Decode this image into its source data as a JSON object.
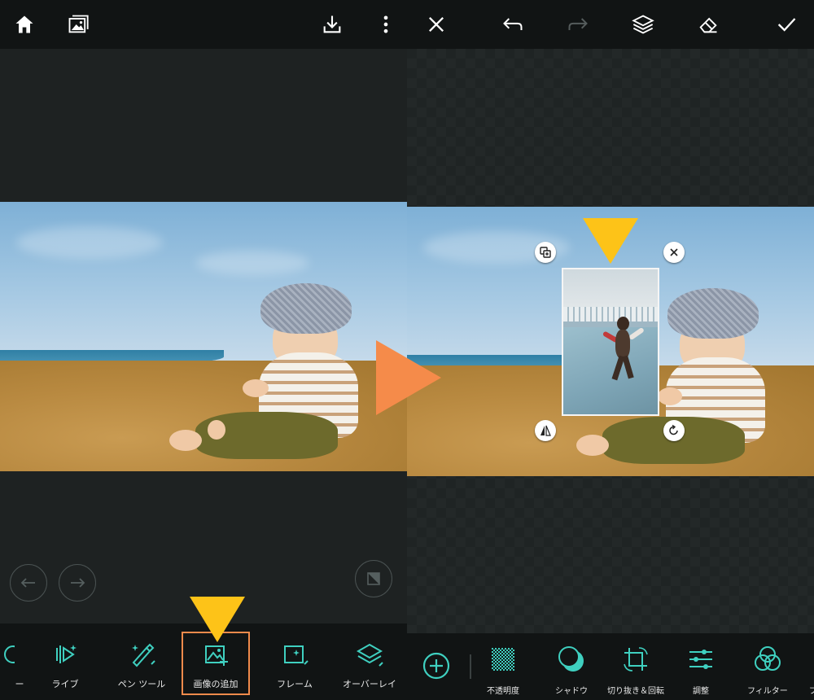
{
  "left_screen": {
    "toolbar": {
      "items": [
        {
          "label": "ー",
          "icon": "partial-tool-icon"
        },
        {
          "label": "ライブ",
          "icon": "live-icon"
        },
        {
          "label": "ペン ツール",
          "icon": "pen-tool-icon"
        },
        {
          "label": "画像の追加",
          "icon": "add-image-icon"
        },
        {
          "label": "フレーム",
          "icon": "frame-icon"
        },
        {
          "label": "オーバーレイ",
          "icon": "overlay-icon"
        }
      ],
      "selected_label": "画像の追加"
    }
  },
  "right_screen": {
    "toolbar": {
      "items": [
        {
          "label": "不透明度",
          "icon": "opacity-icon"
        },
        {
          "label": "シャドウ",
          "icon": "shadow-icon"
        },
        {
          "label": "切り抜き＆回転",
          "icon": "crop-rotate-icon"
        },
        {
          "label": "調整",
          "icon": "adjust-icon"
        },
        {
          "label": "フィルター",
          "icon": "filter-icon"
        },
        {
          "label": "ブレ",
          "icon": "partial-tool-icon"
        }
      ]
    }
  },
  "colors": {
    "accent": "#3fd0c0",
    "highlight_border": "#f08a4b",
    "arrow_yellow": "#fdc318",
    "arrow_orange": "#f58b4a",
    "bar_background": "#111414"
  }
}
